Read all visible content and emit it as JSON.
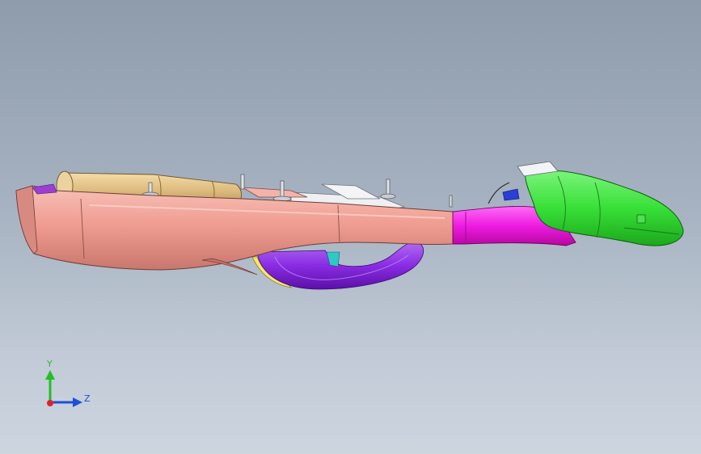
{
  "viewport": {
    "background_top": "#8e9cab",
    "background_bottom": "#cdd5df"
  },
  "model": {
    "parts": [
      {
        "name": "main-housing",
        "color": "#f2a49a"
      },
      {
        "name": "battery-cylinder",
        "color": "#e3c38a"
      },
      {
        "name": "handle-loop",
        "color": "#8a2be2"
      },
      {
        "name": "neck-connector",
        "color": "#f21ee6"
      },
      {
        "name": "head-attachment",
        "color": "#33e633"
      },
      {
        "name": "cable-strip",
        "color": "#f5e66a"
      }
    ]
  },
  "triad": {
    "y_label": "Y",
    "z_label": "Z",
    "y_color": "#22c022",
    "z_color": "#1e4fd8",
    "x_color": "#e0202a"
  }
}
